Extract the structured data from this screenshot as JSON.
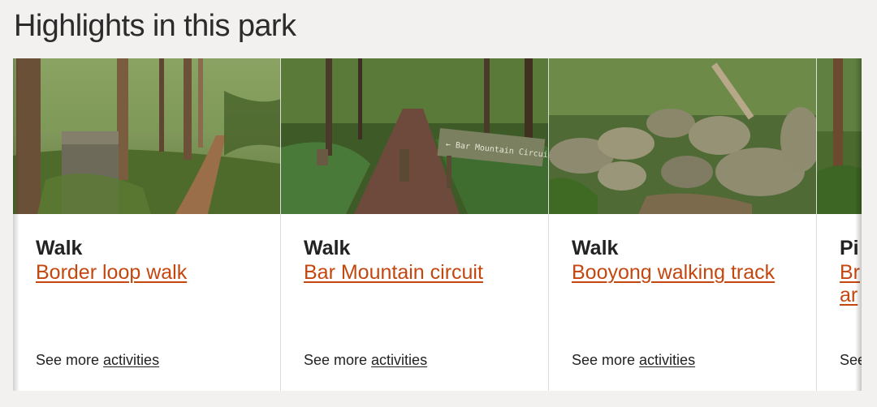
{
  "section": {
    "heading": "Highlights in this park"
  },
  "cards": [
    {
      "type": "Walk",
      "title": "Border loop walk",
      "more_prefix": "See more ",
      "more_link": "activities"
    },
    {
      "type": "Walk",
      "title": "Bar Mountain circuit",
      "more_prefix": "See more ",
      "more_link": "activities",
      "sign_text": "← Bar Mountain Circuit"
    },
    {
      "type": "Walk",
      "title": "Booyong walking track",
      "more_prefix": "See more ",
      "more_link": "activities"
    },
    {
      "type": "Pi",
      "title": "Br ar",
      "more_prefix": "See",
      "more_link": ""
    }
  ],
  "colors": {
    "page_background": "#f2f1ef",
    "card_background": "#ffffff",
    "link": "#c4470f",
    "text": "#222222"
  }
}
